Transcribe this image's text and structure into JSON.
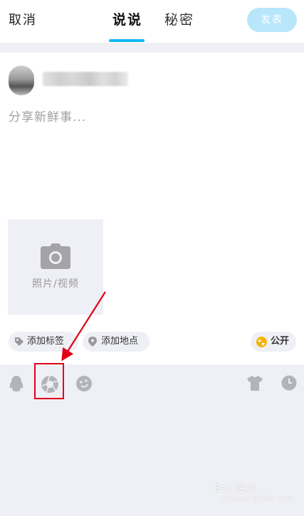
{
  "header": {
    "cancel_label": "取消",
    "tabs": [
      {
        "label": "说说"
      },
      {
        "label": "秘密"
      }
    ],
    "publish_label": "发表"
  },
  "composer": {
    "placeholder": "分享新鲜事...",
    "media_label": "照片/视频"
  },
  "chips": {
    "add_tag": "添加标签",
    "add_location": "添加地点",
    "visibility": "公开"
  },
  "toolbar": {
    "icons": [
      "qq-penguin-icon",
      "camera-shutter-icon",
      "emoji-icon",
      "tshirt-icon",
      "clock-icon"
    ]
  },
  "watermark": {
    "text": "Bai 经验",
    "sub": "jingyan.baidu.com"
  },
  "colors": {
    "accent": "#12b7f5",
    "publish_disabled": "#b8e6fb",
    "annotation_red": "#e0001a",
    "background": "#eff0f5"
  }
}
